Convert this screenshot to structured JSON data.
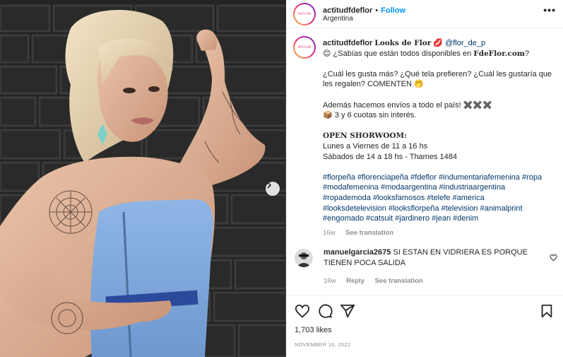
{
  "post": {
    "account": {
      "username": "actitudfdeflor",
      "avatar_text": "#FLOR",
      "location": "Argentina",
      "follow_label": "Follow",
      "separator": "•",
      "more_label": "•••"
    },
    "caption": {
      "username": "actitudfdeflor",
      "title": "Looks de Flor",
      "lips_emoji": "💋",
      "mention": "@flor_de_p",
      "smile_emoji": "😊",
      "line1_text": "¿Sabías que están todos disponibles en",
      "site": "FdeFlor.com",
      "line1_end": "?",
      "paragraph2_text": "¿Cuál les gusta más? ¿Qué tela prefieren? ¿Cuál les gustaría que les regalen? COMENTEN",
      "paragraph2_emoji": "🤭",
      "paragraph3_text": "Además hacemos envíos a todo el país!",
      "paragraph3_emojis": "✖️✖️✖️",
      "paragraph3b_emoji": "📦",
      "paragraph3b_text": "3 y 6 cuotas sin interés.",
      "showroom_title": "OPEN SHORWOOM:",
      "showroom_line1": "Lunes a Viernes de 11 a 16 hs",
      "showroom_line2": "Sábados de 14 a 18 hs - Thames 1484",
      "hashtags": [
        "#florpeña",
        "#florenciapeña",
        "#fdeflor",
        "#indumentariafemenina",
        "#ropa",
        "#modafemenina",
        "#modaargentina",
        "#industriaargentina",
        "#ropademoda",
        "#looksfamosos",
        "#telefe",
        "#america",
        "#looksdetelevision",
        "#looksflorpeña",
        "#television",
        "#animalprint",
        "#engomado",
        "#catsuit",
        "#jardinero",
        "#jean",
        "#denim"
      ],
      "time": "16w",
      "see_translation": "See translation"
    },
    "comment": {
      "username": "manuelgarcia2675",
      "text": "SI ESTAN EN VIDRIERA ES PORQUE TIENEN POCA SALIDA",
      "time": "16w",
      "reply_label": "Reply",
      "see_translation": "See translation"
    },
    "stats": {
      "likes": "1,703 likes",
      "date": "NOVEMBER 16, 2022"
    },
    "icons": {
      "like": "heart-icon",
      "comment": "comment-icon",
      "share": "share-icon",
      "save": "bookmark-icon",
      "more": "more-options-icon",
      "next": "chevron-right-icon"
    },
    "colors": {
      "follow": "#0095f6",
      "hashtag": "#00376b",
      "muted": "#8e8e8e",
      "text": "#262626"
    }
  }
}
